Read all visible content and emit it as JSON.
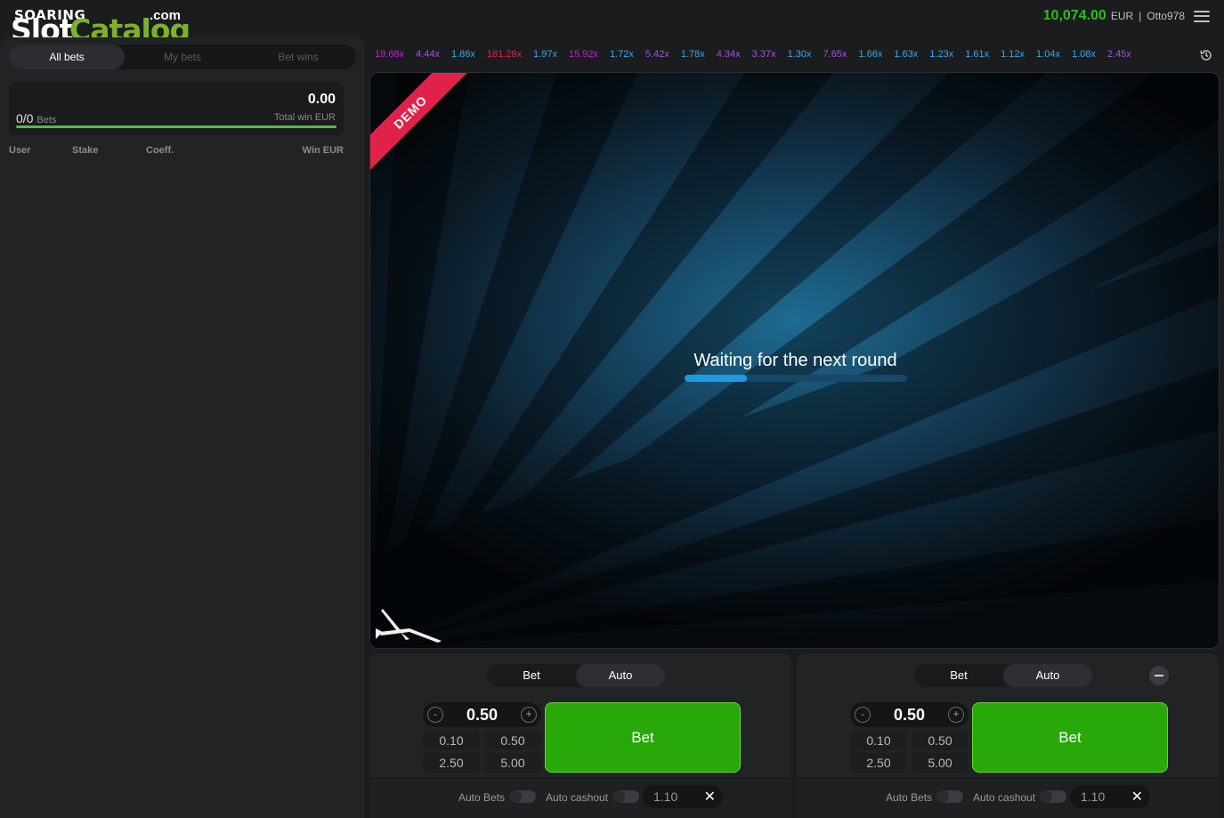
{
  "header": {
    "logo": {
      "top": "SOARING",
      "slot": "Slot",
      "catalog": "Catalog",
      "com": ".com"
    },
    "balance": "10,074.00",
    "currency": "EUR",
    "separator": "|",
    "username": "Otto978"
  },
  "left_panel": {
    "tabs": [
      "All bets",
      "My bets",
      "Bet wins"
    ],
    "stats": {
      "count": "0/0",
      "count_label": "Bets",
      "total_win": "0.00",
      "total_win_label": "Total win EUR"
    },
    "columns": [
      "User",
      "Stake",
      "Coeff.",
      "Win EUR"
    ]
  },
  "multipliers": [
    {
      "value": "19.68x",
      "color": "#c41fd8"
    },
    {
      "value": "4.44x",
      "color": "#a64fe8"
    },
    {
      "value": "1.86x",
      "color": "#3aa7f0"
    },
    {
      "value": "181.28x",
      "color": "#e0214a"
    },
    {
      "value": "1.97x",
      "color": "#3aa7f0"
    },
    {
      "value": "15.92x",
      "color": "#c41fd8"
    },
    {
      "value": "1.72x",
      "color": "#3aa7f0"
    },
    {
      "value": "5.42x",
      "color": "#a64fe8"
    },
    {
      "value": "1.78x",
      "color": "#3aa7f0"
    },
    {
      "value": "4.34x",
      "color": "#a64fe8"
    },
    {
      "value": "3.37x",
      "color": "#a64fe8"
    },
    {
      "value": "1.30x",
      "color": "#3aa7f0"
    },
    {
      "value": "7.65x",
      "color": "#a64fe8"
    },
    {
      "value": "1.66x",
      "color": "#3aa7f0"
    },
    {
      "value": "1.63x",
      "color": "#3aa7f0"
    },
    {
      "value": "1.23x",
      "color": "#3aa7f0"
    },
    {
      "value": "1.61x",
      "color": "#3aa7f0"
    },
    {
      "value": "1.12x",
      "color": "#3aa7f0"
    },
    {
      "value": "1.04x",
      "color": "#3aa7f0"
    },
    {
      "value": "1.08x",
      "color": "#3aa7f0"
    },
    {
      "value": "2.45x",
      "color": "#a64fe8"
    }
  ],
  "game": {
    "demo_label": "DEMO",
    "status_text": "Waiting for the next round",
    "waiting_progress": 0.28
  },
  "bet_panels": [
    {
      "tabs": [
        "Bet",
        "Auto"
      ],
      "stake": "0.50",
      "quick_amounts": [
        "0.10",
        "0.50",
        "2.50",
        "5.00"
      ],
      "bet_label": "Bet",
      "auto_bets_label": "Auto Bets",
      "auto_cashout_label": "Auto cashout",
      "auto_cashout_value": "1.10",
      "clear_symbol": "✕"
    },
    {
      "tabs": [
        "Bet",
        "Auto"
      ],
      "stake": "0.50",
      "quick_amounts": [
        "0.10",
        "0.50",
        "2.50",
        "5.00"
      ],
      "bet_label": "Bet",
      "auto_bets_label": "Auto Bets",
      "auto_cashout_label": "Auto cashout",
      "auto_cashout_value": "1.10",
      "clear_symbol": "✕"
    }
  ],
  "colors": {
    "balance": "#2fba1c",
    "bet_button": "#28a909",
    "demo_ribbon": "#e0214a",
    "progress": "#1e9be0"
  },
  "icons": {
    "menu": "hamburger-menu-icon",
    "history": "history-clock-icon",
    "glider": "glider-plane-icon",
    "minus": "minus-icon",
    "plus": "plus-icon",
    "close": "close-icon"
  }
}
